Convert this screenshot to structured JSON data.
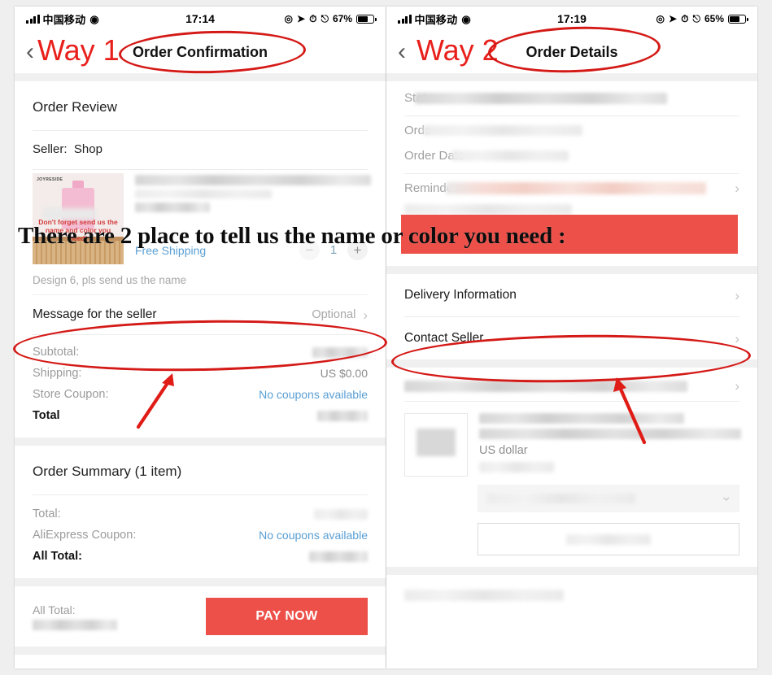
{
  "annotations": {
    "way1": "Way 1",
    "way2": "Way 2",
    "overlay_text": "There are 2 place to tell us the name or color you need :",
    "accent_red": "#d41a17",
    "band_red": "#ec5049"
  },
  "left_phone": {
    "status_bar": {
      "carrier": "中国移动",
      "wifi_icon": "wifi-icon",
      "time": "17:14",
      "battery_percent": "67%",
      "icons": [
        "rotation-lock-icon",
        "location-arrow-icon",
        "alarm-clock-icon",
        "bluetooth-icon"
      ]
    },
    "nav": {
      "back_icon": "chevron-left-icon",
      "title": "Order Confirmation"
    },
    "order_review": {
      "section_title": "Order Review",
      "seller_label": "Seller:",
      "seller_name": "Shop",
      "product": {
        "thumb_brand": "JOYRESIDE",
        "thumb_caption": "Don't forget send us the name and color you need!",
        "shipping_label": "Free Shipping",
        "quantity": "1",
        "minus_icon": "minus-icon",
        "plus_icon": "plus-icon"
      },
      "design_note": "Design 6, pls send us the name",
      "message_row": {
        "label": "Message for the seller",
        "value": "Optional",
        "chevron_icon": "chevron-right-icon"
      },
      "totals": [
        {
          "label": "Subtotal:",
          "value": "",
          "blurred": true
        },
        {
          "label": "Shipping:",
          "value": "US $0.00",
          "blurred": false
        },
        {
          "label": "Store Coupon:",
          "value": "No coupons available",
          "link": true
        },
        {
          "label": "Total",
          "value": "",
          "blurred": true,
          "bold": true
        }
      ]
    },
    "order_summary": {
      "section_title": "Order Summary (1 item)",
      "rows": [
        {
          "label": "Total:",
          "value": "",
          "blurred": true
        },
        {
          "label": "AliExpress Coupon:",
          "value": "No coupons available",
          "link": true
        },
        {
          "label": "All Total:",
          "value": "",
          "blurred": true,
          "bold": true
        }
      ]
    },
    "pay_bar": {
      "all_total_label": "All Total:",
      "pay_button": "PAY NOW"
    }
  },
  "right_phone": {
    "status_bar": {
      "carrier": "中国移动",
      "wifi_icon": "wifi-icon",
      "time": "17:19",
      "battery_percent": "65%",
      "icons": [
        "rotation-lock-icon",
        "location-arrow-icon",
        "alarm-clock-icon",
        "bluetooth-icon"
      ]
    },
    "nav": {
      "back_icon": "chevron-left-icon",
      "title": "Order Details"
    },
    "details": {
      "status_label": "Status:",
      "order_label": "Orde",
      "order_date_label": "Order Date",
      "reminder_label": "Reminder:"
    },
    "actions": [
      {
        "label": "Delivery Information",
        "chevron_icon": "chevron-right-icon"
      },
      {
        "label": "Contact Seller",
        "chevron_icon": "chevron-right-icon"
      }
    ],
    "order_item": {
      "currency_note": "US dollar",
      "dropdown_icon": "chevron-down-icon"
    }
  }
}
